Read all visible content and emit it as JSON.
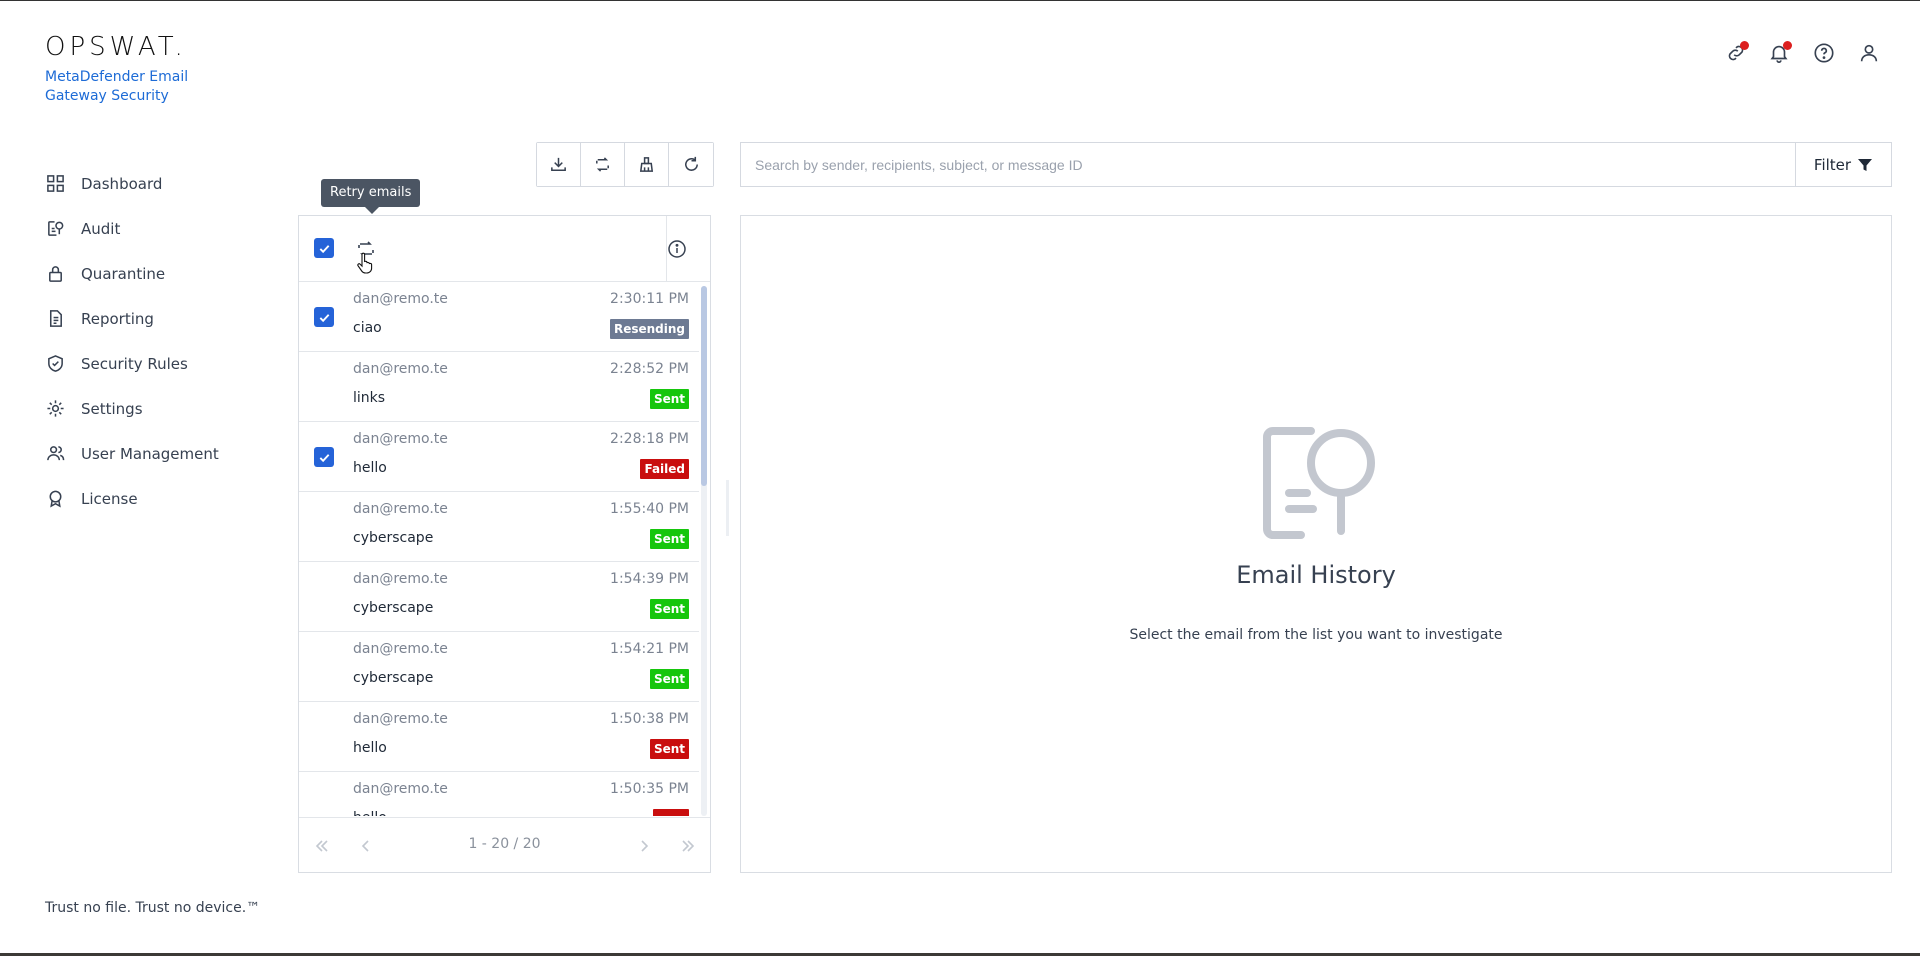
{
  "brand": {
    "logo": "OPSWAT.",
    "product": "MetaDefender Email Gateway Security"
  },
  "sidebar": {
    "items": [
      {
        "label": "Dashboard",
        "icon": "dashboard-icon"
      },
      {
        "label": "Audit",
        "icon": "audit-icon"
      },
      {
        "label": "Quarantine",
        "icon": "lock-icon"
      },
      {
        "label": "Reporting",
        "icon": "document-icon"
      },
      {
        "label": "Security Rules",
        "icon": "shield-check-icon"
      },
      {
        "label": "Settings",
        "icon": "gear-icon"
      },
      {
        "label": "User Management",
        "icon": "users-icon"
      },
      {
        "label": "License",
        "icon": "award-icon"
      }
    ]
  },
  "footer": {
    "tagline": "Trust no file. Trust no device.™"
  },
  "toolbar": {
    "tooltip": "Retry emails"
  },
  "search": {
    "placeholder": "Search by sender, recipients, subject, or message ID",
    "filter_label": "Filter"
  },
  "emails": [
    {
      "sender": "dan@remo.te",
      "time": "2:30:11 PM",
      "subject": "ciao",
      "status": "Resending",
      "selected": true
    },
    {
      "sender": "dan@remo.te",
      "time": "2:28:52 PM",
      "subject": "links",
      "status": "Sent",
      "selected": false
    },
    {
      "sender": "dan@remo.te",
      "time": "2:28:18 PM",
      "subject": "hello",
      "status": "Failed",
      "selected": true
    },
    {
      "sender": "dan@remo.te",
      "time": "1:55:40 PM",
      "subject": "cyberscape",
      "status": "Sent",
      "selected": false
    },
    {
      "sender": "dan@remo.te",
      "time": "1:54:39 PM",
      "subject": "cyberscape",
      "status": "Sent",
      "selected": false
    },
    {
      "sender": "dan@remo.te",
      "time": "1:54:21 PM",
      "subject": "cyberscape",
      "status": "Sent",
      "selected": false
    },
    {
      "sender": "dan@remo.te",
      "time": "1:50:38 PM",
      "subject": "hello",
      "status": "Sent",
      "selected": false
    },
    {
      "sender": "dan@remo.te",
      "time": "1:50:35 PM",
      "subject": "hello",
      "status": "",
      "selected": false
    }
  ],
  "pagination": {
    "range": "1 - 20 / 20"
  },
  "detail": {
    "title": "Email History",
    "subtitle": "Select the email from the list you want to investigate"
  },
  "colors": {
    "accent": "#2563d8",
    "brand_blue": "#1d6bd6",
    "sent": "#16c60c",
    "failed": "#c90e0e",
    "resending": "#6d7a93"
  }
}
